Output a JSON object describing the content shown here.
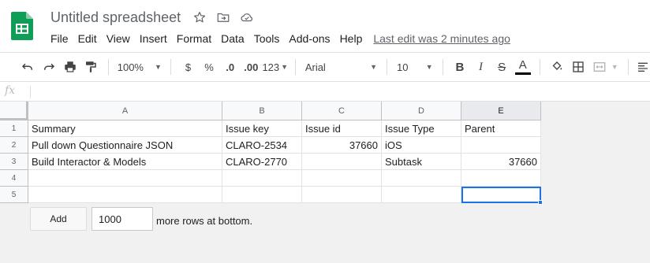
{
  "document": {
    "title": "Untitled spreadsheet"
  },
  "icons": {
    "title": [
      "star-icon",
      "move-to-folder-icon",
      "cloud-status-icon"
    ]
  },
  "menu": {
    "items": [
      "File",
      "Edit",
      "View",
      "Insert",
      "Format",
      "Data",
      "Tools",
      "Add-ons",
      "Help"
    ],
    "last_edit": "Last edit was 2 minutes ago"
  },
  "toolbar": {
    "zoom": "100%",
    "currency": "$",
    "percent": "%",
    "decrease_decimals": ".0",
    "increase_decimals": ".00",
    "more_formats": "123",
    "font": "Arial",
    "font_size": "10",
    "bold": "B",
    "italic": "I",
    "strikethrough": "S",
    "text_color_letter": "A",
    "text_color": "#000000"
  },
  "formula_bar": {
    "fx_label": "fx",
    "value": ""
  },
  "sheet": {
    "columns": [
      "A",
      "B",
      "C",
      "D",
      "E"
    ],
    "selected_column": "E",
    "rows": [
      "1",
      "2",
      "3",
      "4",
      "5"
    ],
    "cells": [
      [
        "Summary",
        "Issue key",
        "Issue id",
        "Issue Type",
        "Parent"
      ],
      [
        "Pull down Questionnaire JSON",
        "CLARO-2534",
        "37660",
        "iOS",
        ""
      ],
      [
        "Build Interactor & Models",
        "CLARO-2770",
        "",
        "Subtask",
        "37660"
      ],
      [
        "",
        "",
        "",
        "",
        ""
      ],
      [
        "",
        "",
        "",
        "",
        ""
      ]
    ],
    "numeric_cells": [
      [
        1,
        2
      ],
      [
        2,
        4
      ]
    ],
    "active_cell": "E5",
    "accent_color": "#1a73e8"
  },
  "add_rows": {
    "button_label": "Add",
    "count": "1000",
    "suffix": "more rows at bottom."
  }
}
